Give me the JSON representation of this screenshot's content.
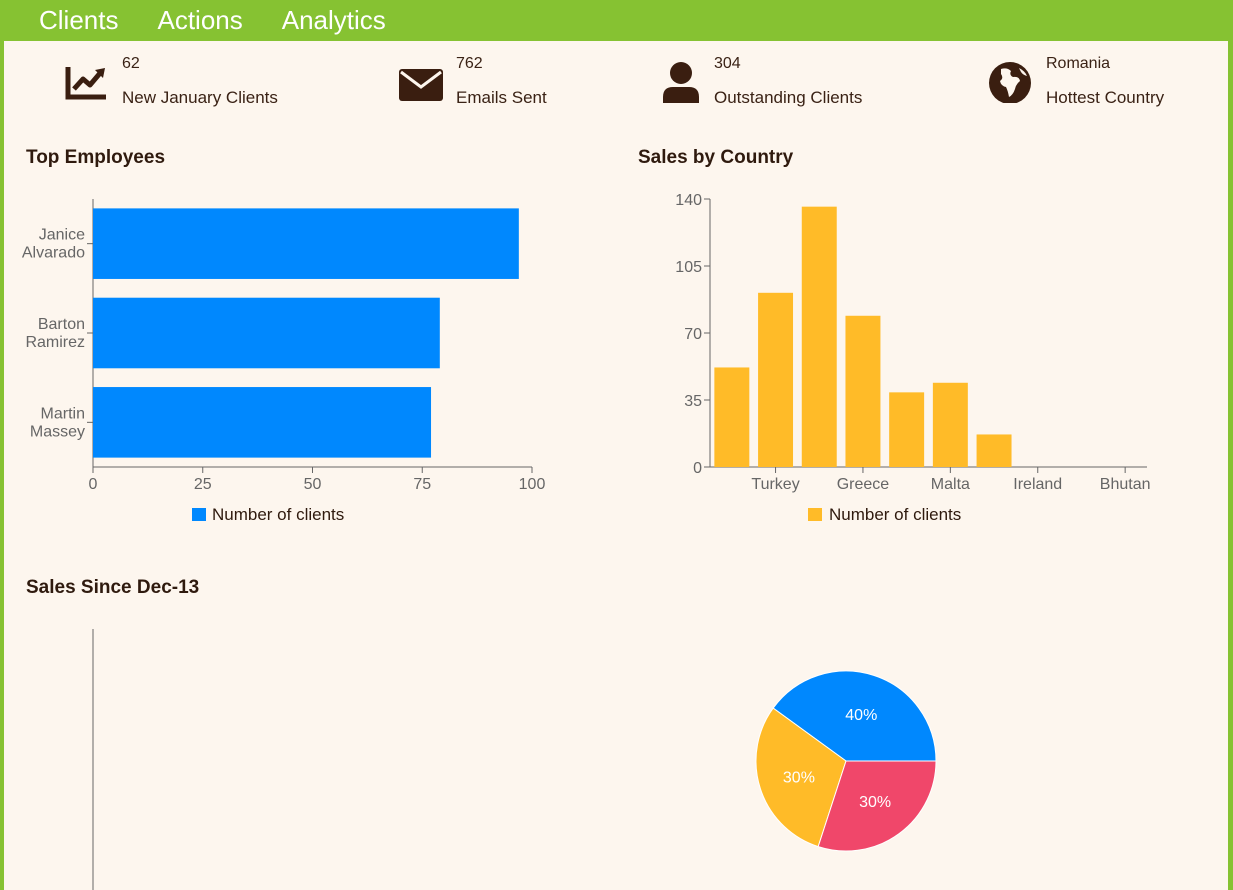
{
  "nav": {
    "items": [
      {
        "label": "Clients"
      },
      {
        "label": "Actions"
      },
      {
        "label": "Analytics"
      }
    ]
  },
  "kpis": [
    {
      "value": "62",
      "label": "New January Clients",
      "icon": "trending-chart-icon"
    },
    {
      "value": "762",
      "label": "Emails Sent",
      "icon": "envelope-icon"
    },
    {
      "value": "304",
      "label": "Outstanding Clients",
      "icon": "user-icon"
    },
    {
      "value": "Romania",
      "label": "Hottest Country",
      "icon": "globe-icon"
    }
  ],
  "colors": {
    "nav_bg": "#86c232",
    "panel_bg": "#fdf6ee",
    "blue": "#0088fe",
    "yellow": "#ffbb28",
    "red": "#f0476a",
    "text_dark": "#2f1a0e",
    "axis": "#666666"
  },
  "sections": {
    "top_employees": "Top Employees",
    "sales_by_country": "Sales by Country",
    "sales_since": "Sales Since Dec-13"
  },
  "chart_data": [
    {
      "id": "employees",
      "type": "bar",
      "orientation": "horizontal",
      "title": "Top Employees",
      "categories": [
        [
          "Janice",
          "Alvarado"
        ],
        [
          "Barton",
          "Ramirez"
        ],
        [
          "Martin",
          "Massey"
        ]
      ],
      "series": [
        {
          "name": "Number of clients",
          "values": [
            97,
            79,
            77
          ],
          "color": "#0088fe"
        }
      ],
      "xlim": [
        0,
        100
      ],
      "xticks": [
        0,
        25,
        50,
        75,
        100
      ],
      "legend": "bottom"
    },
    {
      "id": "countries",
      "type": "bar",
      "title": "Sales by Country",
      "categories": [
        "",
        "Turkey",
        "",
        "Greece",
        "",
        "Malta",
        "",
        "Ireland",
        "",
        "Bhutan"
      ],
      "series": [
        {
          "name": "Number of clients",
          "values": [
            52,
            91,
            136,
            79,
            39,
            44,
            17,
            0,
            0,
            0
          ],
          "color": "#ffbb28"
        }
      ],
      "ylim": [
        0,
        140
      ],
      "yticks": [
        0,
        35,
        70,
        105,
        140
      ],
      "legend": "bottom"
    },
    {
      "id": "pie",
      "type": "pie",
      "slices": [
        {
          "label": "40%",
          "value": 40,
          "color": "#0088fe"
        },
        {
          "label": "30%",
          "value": 30,
          "color": "#ffbb28"
        },
        {
          "label": "30%",
          "value": 30,
          "color": "#f0476a"
        }
      ]
    }
  ]
}
